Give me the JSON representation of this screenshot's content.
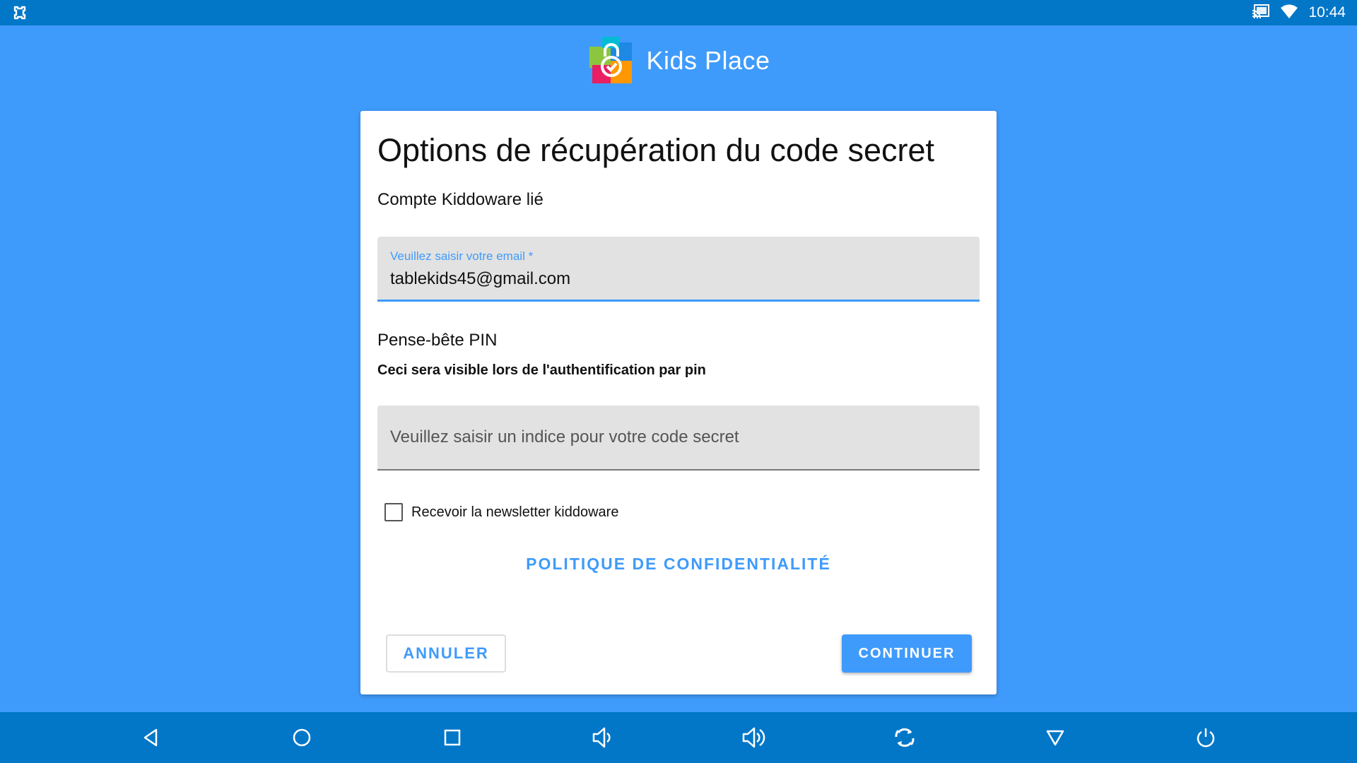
{
  "status_bar": {
    "time": "10:44",
    "icons": [
      "kids-place-notification-icon",
      "cast-icon",
      "wifi-icon"
    ]
  },
  "header": {
    "app_name": "Kids Place",
    "logo_icon": "kids-place-logo-icon"
  },
  "dialog": {
    "title": "Options de récupération du code secret",
    "linked_account_label": "Compte Kiddoware lié",
    "email_field": {
      "label": "Veuillez saisir votre email *",
      "value": "tablekids45@gmail.com"
    },
    "pin_reminder_label": "Pense-bête PIN",
    "pin_reminder_hint": "Ceci sera visible lors de l'authentification par pin",
    "hint_field": {
      "placeholder": "Veuillez saisir un indice pour votre code secret",
      "value": ""
    },
    "newsletter_checkbox": {
      "label": "Recevoir la newsletter kiddoware",
      "checked": false
    },
    "privacy_link": "POLITIQUE DE CONFIDENTIALITÉ",
    "cancel_button": "ANNULER",
    "continue_button": "CONTINUER"
  },
  "nav_bar": {
    "buttons": [
      "back-icon",
      "home-icon",
      "recents-icon",
      "volume-down-icon",
      "volume-up-icon",
      "rotate-icon",
      "hide-nav-icon",
      "power-icon"
    ]
  },
  "colors": {
    "background": "#3f9bfb",
    "bars": "#0277c8",
    "accent": "#3f9bfb",
    "card": "#ffffff"
  }
}
